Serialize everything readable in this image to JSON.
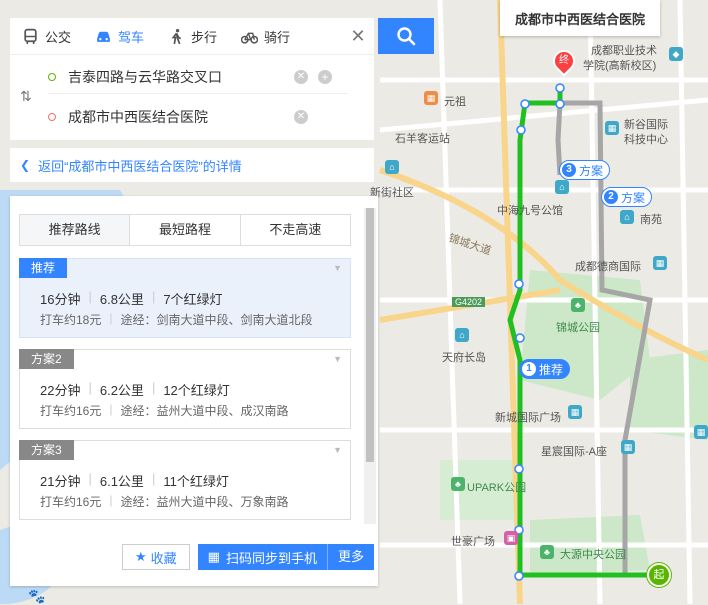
{
  "modes": [
    {
      "label": "公交",
      "icon": "bus-icon"
    },
    {
      "label": "驾车",
      "icon": "car-icon",
      "active": true
    },
    {
      "label": "步行",
      "icon": "walk-icon"
    },
    {
      "label": "骑行",
      "icon": "bike-icon"
    }
  ],
  "inputs": {
    "origin": "吉泰四路与云华路交叉口",
    "destination": "成都市中西医结合医院"
  },
  "back_link": "返回“成都市中西医结合医院”的详情",
  "tabs": [
    "推荐路线",
    "最短路程",
    "不走高速"
  ],
  "routes": [
    {
      "tag": "推荐",
      "time": "16分钟",
      "distance": "6.8公里",
      "lights": "7个红绿灯",
      "taxi": "打车约18元",
      "via": "途经：剑南大道中段、剑南大道北段"
    },
    {
      "tag": "方案2",
      "time": "22分钟",
      "distance": "6.2公里",
      "lights": "12个红绿灯",
      "taxi": "打车约16元",
      "via": "途经：益州大道中段、成汉南路"
    },
    {
      "tag": "方案3",
      "time": "21分钟",
      "distance": "6.1公里",
      "lights": "11个红绿灯",
      "taxi": "打车约16元",
      "via": "途经：益州大道中段、万象南路"
    }
  ],
  "actions": {
    "favorite": "收藏",
    "sync": "扫码同步到手机",
    "more": "更多"
  },
  "map": {
    "dest_card": "成都市中西医结合医院",
    "end_marker": "终",
    "start_marker": "起",
    "labels": [
      {
        "text": "成都职业技术",
        "name": "poi-label-vocational"
      },
      {
        "text": "学院(高新校区)",
        "name": "poi-label-vocational-2"
      },
      {
        "text": "元祖",
        "name": "poi-label-yuanzu"
      },
      {
        "text": "新谷国际",
        "name": "poi-label-xingu"
      },
      {
        "text": "科技中心",
        "name": "poi-label-xingu-2"
      },
      {
        "text": "石羊客运站",
        "name": "poi-label-shiyang"
      },
      {
        "text": "新街社区",
        "name": "poi-label-xinjie"
      },
      {
        "text": "中海九号公馆",
        "name": "poi-label-zhonghai"
      },
      {
        "text": "南苑",
        "name": "poi-label-nanyuan"
      },
      {
        "text": "锦城大道",
        "name": "road-label-jincheng"
      },
      {
        "text": "成都德商国际",
        "name": "poi-label-deshang"
      },
      {
        "text": "G4202",
        "name": "road-label-g4202"
      },
      {
        "text": "锦城公园",
        "name": "poi-label-jincheng-park"
      },
      {
        "text": "天府长岛",
        "name": "poi-label-tianfu"
      },
      {
        "text": "新城国际广场",
        "name": "poi-label-xincheng"
      },
      {
        "text": "星宸国际-A座",
        "name": "poi-label-xingchen"
      },
      {
        "text": "UPARK公园",
        "name": "poi-label-upark"
      },
      {
        "text": "世豪广场",
        "name": "poi-label-shihao"
      },
      {
        "text": "大源中央公园",
        "name": "poi-label-dayuan"
      }
    ],
    "scheme_tags": [
      {
        "num": "3",
        "text": "方案"
      },
      {
        "num": "2",
        "text": "方案"
      },
      {
        "num": "1",
        "text": "推荐"
      }
    ]
  },
  "colors": {
    "accent": "#3385ff",
    "route_primary": "#1fc01f",
    "route_alt": "#a6a6a6"
  }
}
